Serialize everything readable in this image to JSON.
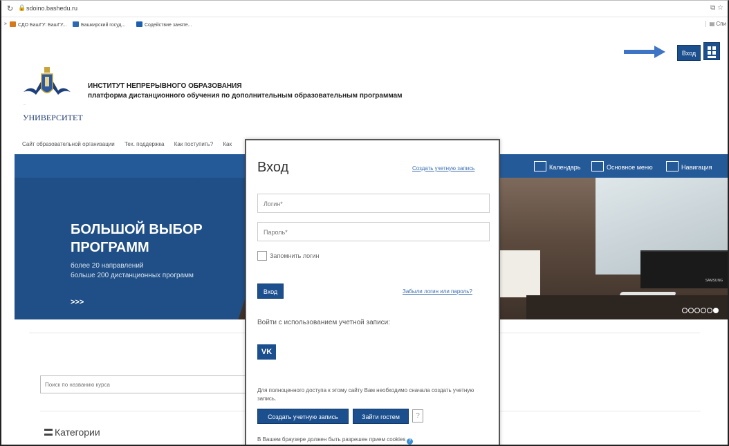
{
  "browser": {
    "url": "sdoino.bashedu.ru",
    "bookmarks": [
      {
        "label": "СДО БашГУ: БашГУ..."
      },
      {
        "label": "Башкирский госуд..."
      },
      {
        "label": "Содействие заняте..."
      }
    ],
    "bookmarks_right": "Спи"
  },
  "header": {
    "login_label": "Вход",
    "university_word": "УНИВЕРСИТЕТ",
    "institute_title": "ИНСТИТУТ НЕПРЕРЫВНОГО ОБРАЗОВАНИЯ",
    "institute_subtitle": "платформа дистанционного обучения по дополнительным образовательным программам"
  },
  "topnav": [
    "Сайт образовательной организации",
    "Тех. поддержка",
    "Как поступить?",
    "Как"
  ],
  "bluebar": {
    "items": [
      {
        "label": "Календарь"
      },
      {
        "label": "Основное меню"
      },
      {
        "label": "Навигация"
      }
    ]
  },
  "hero": {
    "title_line1": "БОЛЬШОЙ ВЫБОР",
    "title_line2": "ПРОГРАММ",
    "line1": "более 20 направлений",
    "line2": "больше 200 дистанционных программ",
    "more": ">>>",
    "tv_label": "SAMSUNG",
    "slide_count": 6,
    "active_slide": 6
  },
  "search": {
    "placeholder": "Поиск по названию курса"
  },
  "categories": {
    "label": "Категории"
  },
  "login_modal": {
    "title": "Вход",
    "create_account_link": "Создать учетную запись",
    "login_placeholder": "Логин*",
    "password_placeholder": "Пароль*",
    "remember_label": "Запомнить логин",
    "submit_label": "Вход",
    "forgot_link": "Забыли логин или пароль?",
    "oauth_label": "Войти с использованием учетной записи:",
    "vk_label": "VK",
    "note": "Для полноценного доступа к этому сайту Вам необходимо сначала создать учетную запись.",
    "create_button": "Создать учетную запись",
    "guest_button": "Зайти гостем",
    "help": "?",
    "cookies_text": "В Вашем браузере должен быть разрешен прием cookies",
    "cookies_help": "?"
  },
  "colors": {
    "primary": "#1c4f8e",
    "bluebar": "#255a99",
    "link": "#3a6db0"
  }
}
